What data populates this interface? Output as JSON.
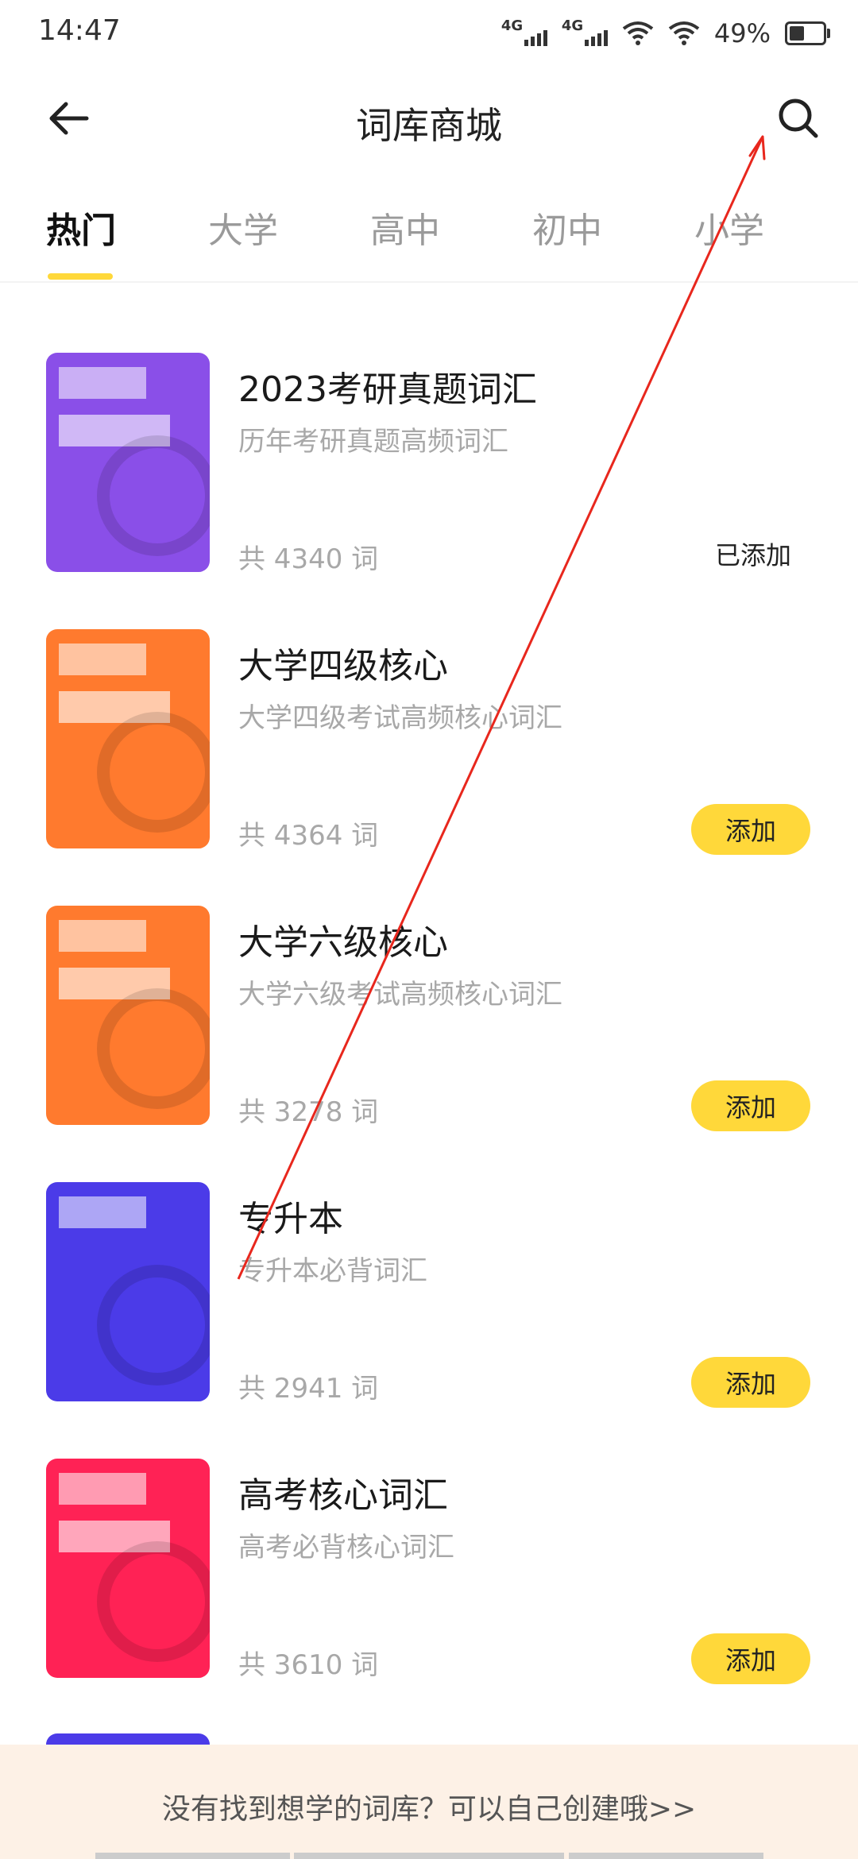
{
  "status_bar": {
    "time": "14:47",
    "network_1": "4G",
    "network_2": "4G",
    "battery_percent": "49%"
  },
  "nav": {
    "title": "词库商城"
  },
  "tabs": [
    {
      "label": "热门",
      "active": true
    },
    {
      "label": "大学",
      "active": false
    },
    {
      "label": "高中",
      "active": false
    },
    {
      "label": "初中",
      "active": false
    },
    {
      "label": "小学",
      "active": false
    }
  ],
  "books": [
    {
      "title": "2023考研真题词汇",
      "subtitle": "历年考研真题高频词汇",
      "count": "共 4340 词",
      "action": "已添加",
      "added": true,
      "cover_color": "#8a4fe8"
    },
    {
      "title": "大学四级核心",
      "subtitle": "大学四级考试高频核心词汇",
      "count": "共 4364 词",
      "action": "添加",
      "added": false,
      "cover_color": "#ff7a2e"
    },
    {
      "title": "大学六级核心",
      "subtitle": "大学六级考试高频核心词汇",
      "count": "共 3278 词",
      "action": "添加",
      "added": false,
      "cover_color": "#ff7a2e"
    },
    {
      "title": "专升本",
      "subtitle": "专升本必背词汇",
      "count": "共 2941 词",
      "action": "添加",
      "added": false,
      "cover_color": "#4b3be8"
    },
    {
      "title": "高考核心词汇",
      "subtitle": "高考必背核心词汇",
      "count": "共 3610 词",
      "action": "添加",
      "added": false,
      "cover_color": "#ff2255"
    }
  ],
  "footer": {
    "text": "没有找到想学的词库？可以自己创建哦>>"
  },
  "colors": {
    "accent": "#ffd83a",
    "annotation_arrow": "#e8271d"
  },
  "icons": {
    "back": "arrow-left-icon",
    "search": "search-icon"
  }
}
